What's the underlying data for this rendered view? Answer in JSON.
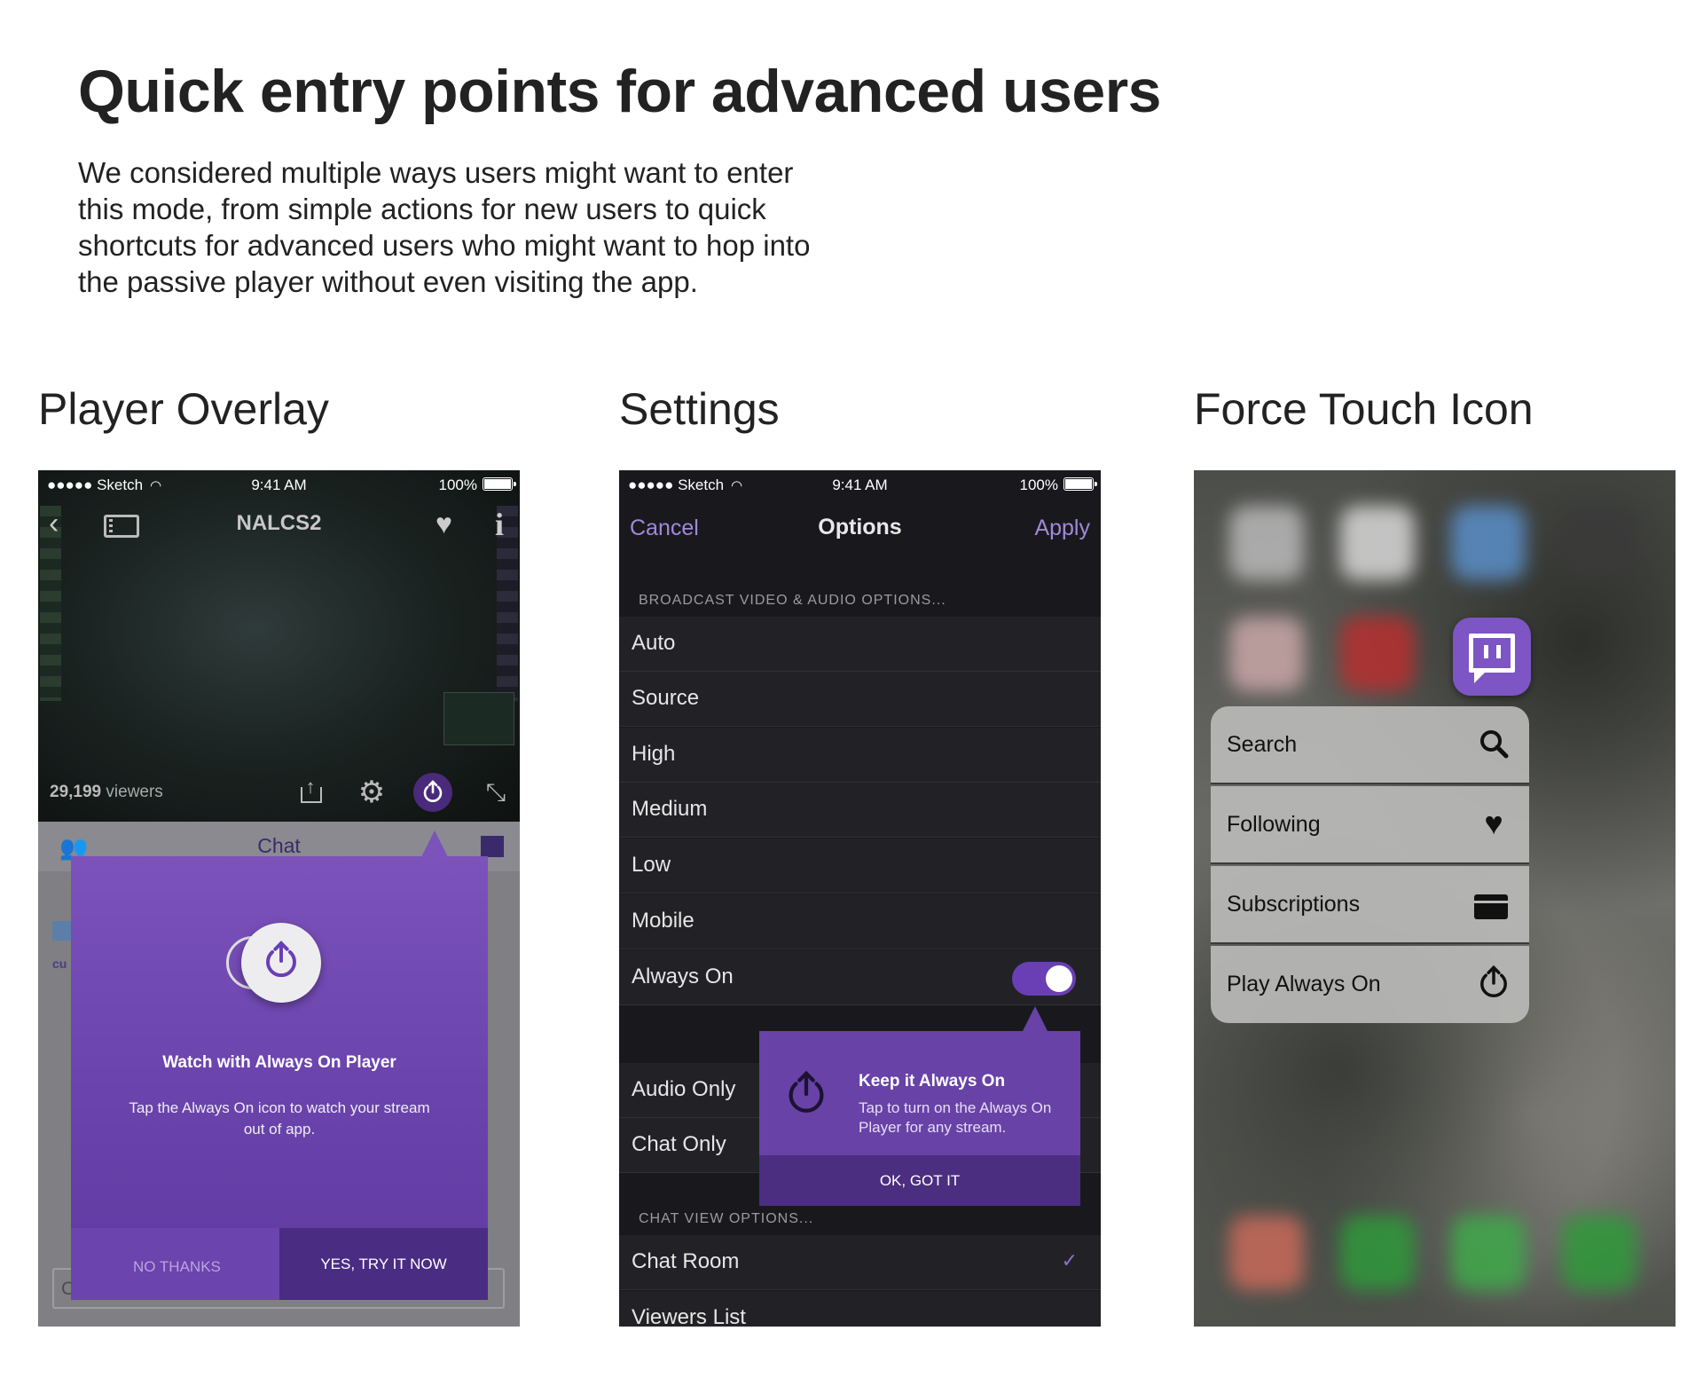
{
  "header": {
    "title": "Quick entry points for advanced users",
    "intro_lines": [
      "We considered multiple ways users might want to enter",
      "this mode, from simple actions for new users to quick",
      "shortcuts for advanced users who might want to hop into",
      "the passive player without even visiting the app."
    ]
  },
  "sections": {
    "player_overlay": "Player Overlay",
    "settings": "Settings",
    "force_touch": "Force Touch Icon"
  },
  "status_bar": {
    "carrier": "●●●●● Sketch",
    "time": "9:41 AM",
    "battery": "100%"
  },
  "player": {
    "channel_title": "NALCS2",
    "viewers_count": "29,199",
    "viewers_label": "viewers",
    "chat_tab": "Chat",
    "chat_placeholder": "Chat about this Channel",
    "chat_user_fragment": "cu",
    "overlay": {
      "title": "Watch with Always On Player",
      "body": "Tap the Always On icon to watch your stream out of app.",
      "no_button": "NO THANKS",
      "yes_button": "YES, TRY IT NOW"
    }
  },
  "settings": {
    "cancel": "Cancel",
    "title": "Options",
    "apply": "Apply",
    "broadcast_header": "BROADCAST VIDEO & AUDIO OPTIONS...",
    "quality_rows": [
      "Auto",
      "Source",
      "High",
      "Medium",
      "Low",
      "Mobile"
    ],
    "always_on_label": "Always On",
    "always_on_enabled": true,
    "audio_only": "Audio Only",
    "chat_only": "Chat Only",
    "chat_header": "CHAT VIEW OPTIONS...",
    "chat_room": "Chat Room",
    "viewers_list": "Viewers List",
    "tooltip": {
      "title": "Keep it Always On",
      "body": "Tap to turn on the Always On Player for any stream.",
      "ok": "OK, GOT IT"
    }
  },
  "force_touch": {
    "menu": [
      {
        "label": "Search",
        "icon": "search-icon"
      },
      {
        "label": "Following",
        "icon": "heart-icon"
      },
      {
        "label": "Subscriptions",
        "icon": "card-icon"
      },
      {
        "label": "Play Always On",
        "icon": "power-icon"
      }
    ]
  },
  "colors": {
    "brand_purple": "#6a3fb5",
    "accent_text": "#a189d8",
    "dark_bg": "#19191d"
  }
}
